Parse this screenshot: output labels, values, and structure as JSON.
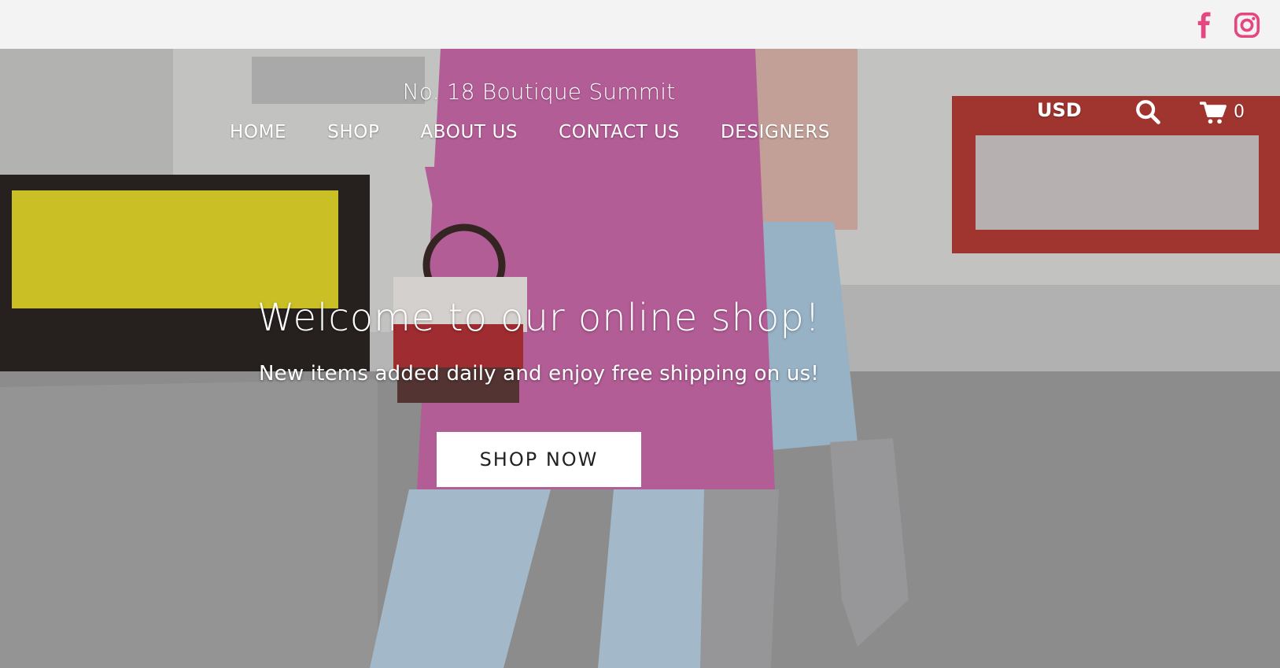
{
  "topbar": {
    "social": [
      {
        "name": "facebook-icon",
        "color": "#e5467f"
      },
      {
        "name": "instagram-icon",
        "color": "#e5467f"
      }
    ]
  },
  "header": {
    "site_title": "No. 18 Boutique Summit",
    "nav": [
      "HOME",
      "SHOP",
      "ABOUT US",
      "CONTACT US",
      "DESIGNERS"
    ],
    "currency": "USD",
    "search_icon": "search-icon",
    "cart_icon": "cart-icon",
    "cart_count": "0"
  },
  "hero": {
    "heading": "Welcome to our online shop!",
    "subheading": "New items added daily and enjoy free shipping on us!",
    "cta_label": "SHOP NOW"
  },
  "colors": {
    "accent": "#e5467f",
    "topbar_bg": "#f3f3f3",
    "text_on_hero": "#ffffff"
  }
}
